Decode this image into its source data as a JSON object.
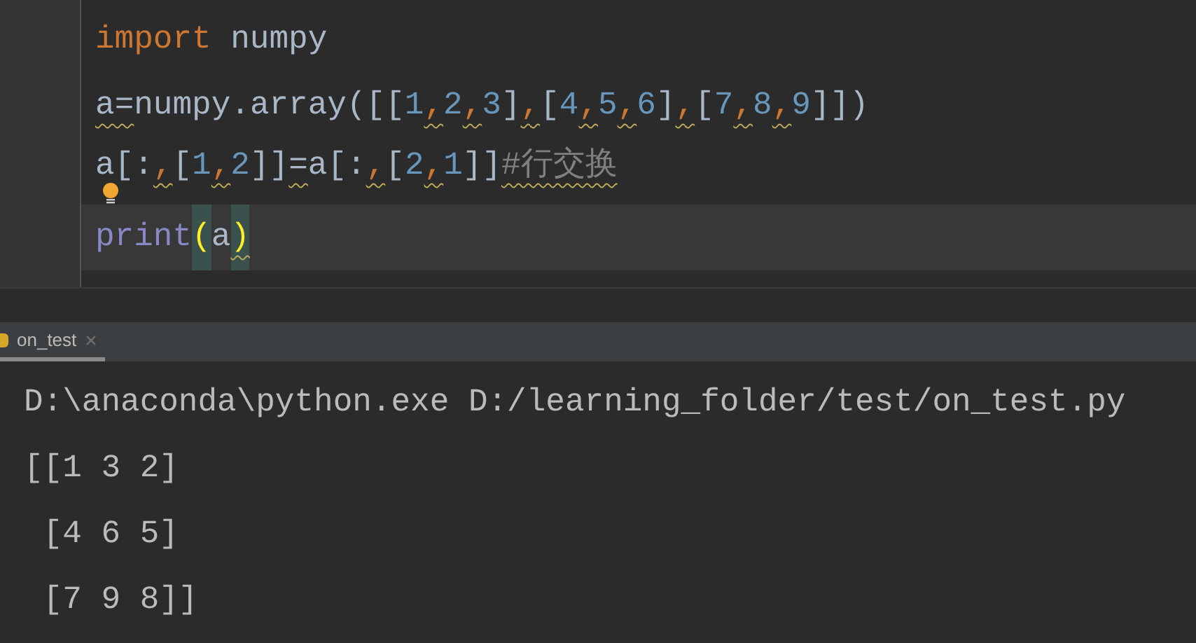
{
  "editor": {
    "lines": [
      {
        "current": false,
        "tokens": [
          {
            "kind": "keyword",
            "text": "import",
            "warn": false
          },
          {
            "kind": "name",
            "text": " numpy",
            "warn": false
          }
        ]
      },
      {
        "current": false,
        "tokens": [
          {
            "kind": "name",
            "text": "a",
            "warn": true
          },
          {
            "kind": "name",
            "text": "=",
            "warn": true
          },
          {
            "kind": "name",
            "text": "numpy.array(",
            "warn": false
          },
          {
            "kind": "name",
            "text": "[[",
            "warn": false
          },
          {
            "kind": "number",
            "text": "1",
            "warn": false
          },
          {
            "kind": "comma",
            "text": ",",
            "warn": true
          },
          {
            "kind": "number",
            "text": "2",
            "warn": false
          },
          {
            "kind": "comma",
            "text": ",",
            "warn": true
          },
          {
            "kind": "number",
            "text": "3",
            "warn": false
          },
          {
            "kind": "name",
            "text": "]",
            "warn": false
          },
          {
            "kind": "comma",
            "text": ",",
            "warn": true
          },
          {
            "kind": "name",
            "text": "[",
            "warn": false
          },
          {
            "kind": "number",
            "text": "4",
            "warn": false
          },
          {
            "kind": "comma",
            "text": ",",
            "warn": true
          },
          {
            "kind": "number",
            "text": "5",
            "warn": false
          },
          {
            "kind": "comma",
            "text": ",",
            "warn": true
          },
          {
            "kind": "number",
            "text": "6",
            "warn": false
          },
          {
            "kind": "name",
            "text": "]",
            "warn": false
          },
          {
            "kind": "comma",
            "text": ",",
            "warn": true
          },
          {
            "kind": "name",
            "text": "[",
            "warn": false
          },
          {
            "kind": "number",
            "text": "7",
            "warn": false
          },
          {
            "kind": "comma",
            "text": ",",
            "warn": true
          },
          {
            "kind": "number",
            "text": "8",
            "warn": false
          },
          {
            "kind": "comma",
            "text": ",",
            "warn": true
          },
          {
            "kind": "number",
            "text": "9",
            "warn": false
          },
          {
            "kind": "name",
            "text": "]])",
            "warn": false
          }
        ]
      },
      {
        "current": false,
        "bulb": true,
        "tokens": [
          {
            "kind": "name",
            "text": "a[:",
            "warn": false
          },
          {
            "kind": "comma",
            "text": ",",
            "warn": true
          },
          {
            "kind": "name",
            "text": "[",
            "warn": false
          },
          {
            "kind": "number",
            "text": "1",
            "warn": false
          },
          {
            "kind": "comma",
            "text": ",",
            "warn": true
          },
          {
            "kind": "number",
            "text": "2",
            "warn": false
          },
          {
            "kind": "name",
            "text": "]]",
            "warn": false
          },
          {
            "kind": "name",
            "text": "=",
            "warn": true
          },
          {
            "kind": "name",
            "text": "a[:",
            "warn": false
          },
          {
            "kind": "comma",
            "text": ",",
            "warn": true
          },
          {
            "kind": "name",
            "text": "[",
            "warn": false
          },
          {
            "kind": "number",
            "text": "2",
            "warn": false
          },
          {
            "kind": "comma",
            "text": ",",
            "warn": true
          },
          {
            "kind": "number",
            "text": "1",
            "warn": false
          },
          {
            "kind": "name",
            "text": "]]",
            "warn": false
          },
          {
            "kind": "comment",
            "text": "#行交换",
            "warn": true
          }
        ]
      },
      {
        "current": true,
        "tokens": [
          {
            "kind": "builtin",
            "text": "print",
            "warn": false
          },
          {
            "kind": "match",
            "text": "(",
            "warn": false
          },
          {
            "kind": "name",
            "text": "a",
            "warn": false
          },
          {
            "kind": "match",
            "text": ")",
            "warn": true
          }
        ]
      }
    ]
  },
  "run_tabs": [
    {
      "label": "on_test",
      "selected": true
    }
  ],
  "console": {
    "lines": [
      "D:\\anaconda\\python.exe D:/learning_folder/test/on_test.py",
      "[[1 3 2]",
      " [4 6 5]",
      " [7 9 8]]"
    ]
  }
}
